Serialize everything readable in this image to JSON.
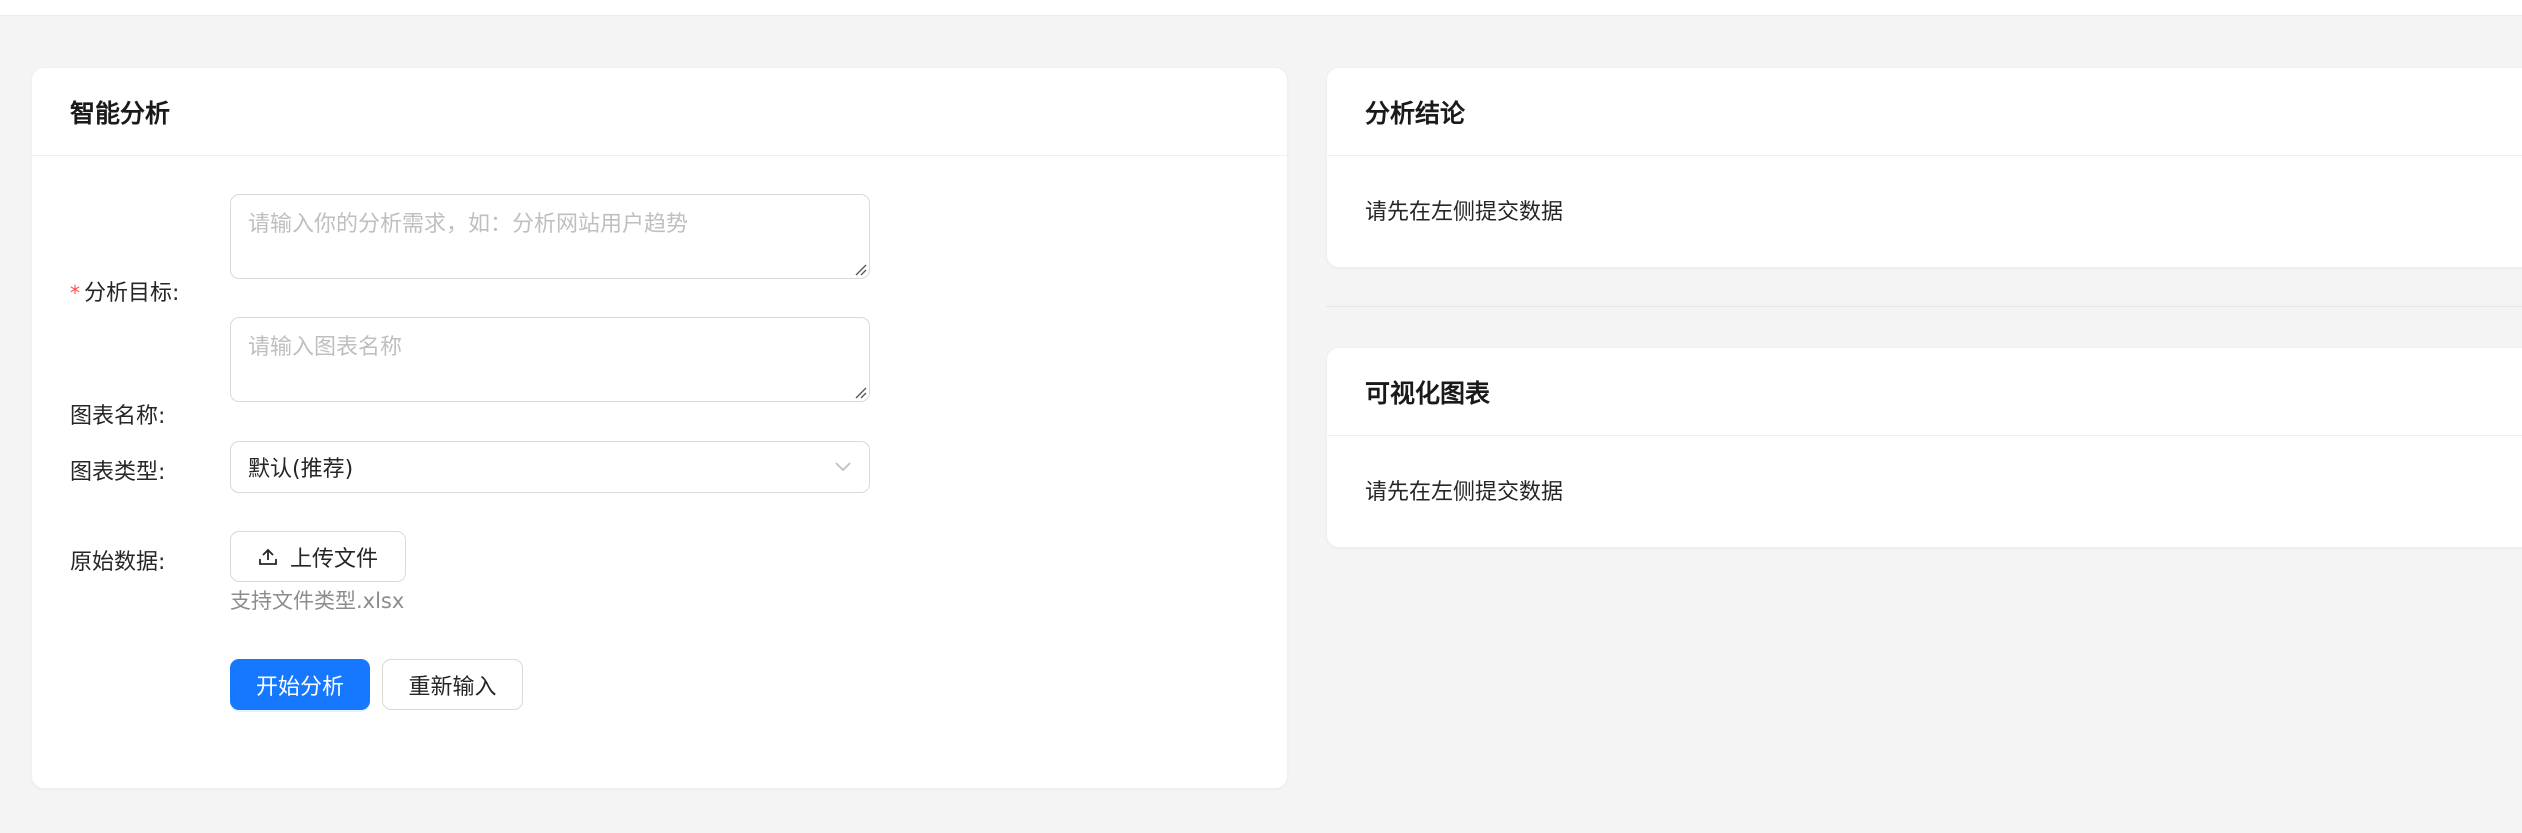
{
  "left_card": {
    "title": "智能分析",
    "goal": {
      "label": "分析目标",
      "required_mark": "*",
      "placeholder": "请输入你的分析需求，如：分析网站用户趋势"
    },
    "chart_name": {
      "label": "图表名称",
      "placeholder": "请输入图表名称"
    },
    "chart_type": {
      "label": "图表类型",
      "selected": "默认(推荐)"
    },
    "raw_data": {
      "label": "原始数据",
      "upload_label": "上传文件",
      "hint": "支持文件类型.xlsx"
    },
    "actions": {
      "submit": "开始分析",
      "reset": "重新输入"
    }
  },
  "conclusion_card": {
    "title": "分析结论",
    "empty_text": "请先在左侧提交数据"
  },
  "chart_card": {
    "title": "可视化图表",
    "empty_text": "请先在左侧提交数据"
  },
  "colors": {
    "primary": "#1677ff",
    "required": "#ff4d4f"
  }
}
